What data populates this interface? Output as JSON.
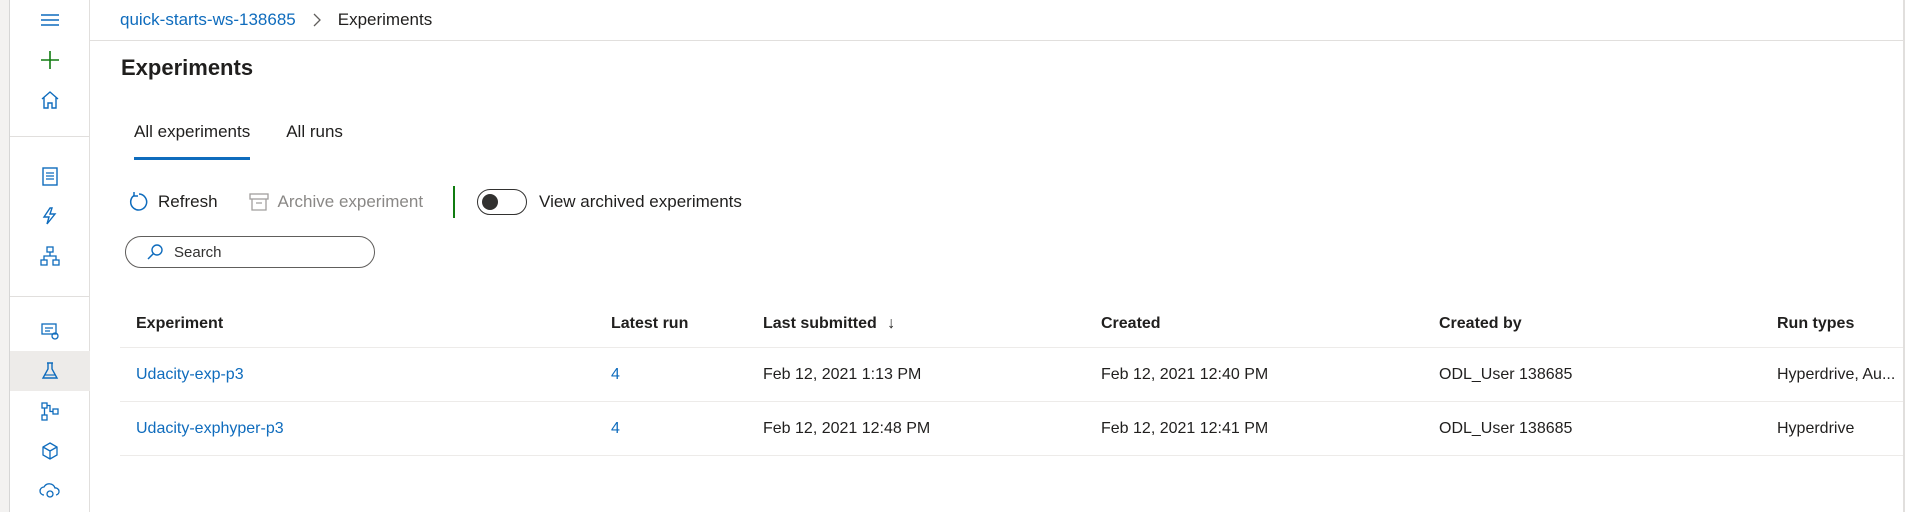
{
  "breadcrumb": {
    "workspace": "quick-starts-ws-138685",
    "current": "Experiments"
  },
  "page": {
    "title": "Experiments"
  },
  "tabs": [
    {
      "label": "All experiments",
      "active": true
    },
    {
      "label": "All runs",
      "active": false
    }
  ],
  "toolbar": {
    "refresh": "Refresh",
    "archive": "Archive experiment",
    "view_archived": "View archived experiments",
    "view_archived_on": false
  },
  "search": {
    "placeholder": "Search"
  },
  "table": {
    "columns": [
      "Experiment",
      "Latest run",
      "Last submitted",
      "Created",
      "Created by",
      "Run types"
    ],
    "sort_indicator": "↓",
    "rows": [
      {
        "experiment": "Udacity-exp-p3",
        "latest_run": "4",
        "last_submitted": "Feb 12, 2021 1:13 PM",
        "created": "Feb 12, 2021 12:40 PM",
        "created_by": "ODL_User 138685",
        "run_types": "Hyperdrive, Au..."
      },
      {
        "experiment": "Udacity-exphyper-p3",
        "latest_run": "4",
        "last_submitted": "Feb 12, 2021 12:48 PM",
        "created": "Feb 12, 2021 12:41 PM",
        "created_by": "ODL_User 138685",
        "run_types": "Hyperdrive"
      }
    ]
  },
  "sidebar": {
    "icons": [
      "hamburger-icon",
      "add-icon",
      "home-icon",
      "notebook-icon",
      "automl-icon",
      "designer-icon",
      "datasets-icon",
      "experiments-icon",
      "pipelines-icon",
      "models-icon",
      "endpoints-icon"
    ],
    "active": "experiments-icon"
  },
  "colors": {
    "accent": "#0f6cbd",
    "add": "#107c10"
  }
}
